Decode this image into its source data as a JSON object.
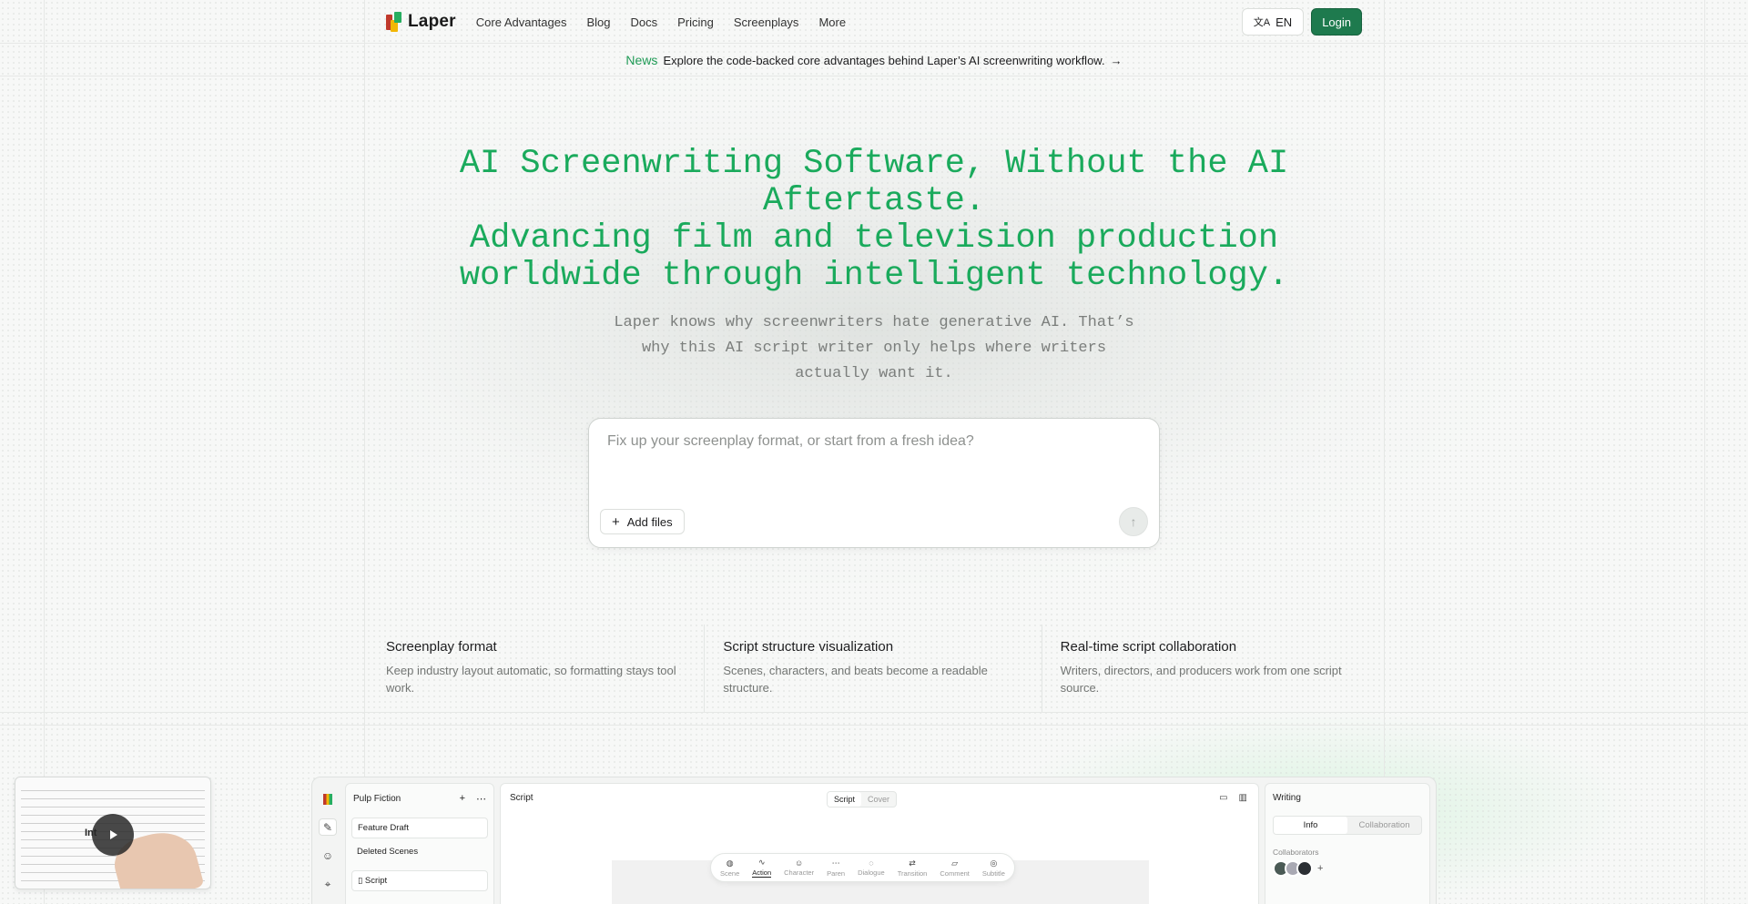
{
  "brand": {
    "name": "Laper"
  },
  "nav": {
    "items": [
      "Core Advantages",
      "Blog",
      "Docs",
      "Pricing",
      "Screenplays",
      "More"
    ]
  },
  "header": {
    "lang_label": "EN",
    "login_label": "Login"
  },
  "news": {
    "tag": "News",
    "text": "Explore the code-backed core advantages behind Laper’s AI screenwriting workflow.",
    "arrow": "→"
  },
  "hero": {
    "title_line1": "AI Screenwriting Software, Without the AI Aftertaste.",
    "title_line2": "Advancing film and television production worldwide through intelligent technology.",
    "subtitle": "Laper knows why screenwriters hate generative AI. That’s why this AI script writer only helps where writers actually want it."
  },
  "prompt": {
    "placeholder": "Fix up your screenplay format, or start from a fresh idea?",
    "value": "",
    "add_files_label": "Add files"
  },
  "features": [
    {
      "title": "Screenplay format",
      "desc": "Keep industry layout automatic, so formatting stays tool work."
    },
    {
      "title": "Script structure visualization",
      "desc": "Scenes, characters, and beats become a readable structure."
    },
    {
      "title": "Real-time script collaboration",
      "desc": "Writers, directors, and producers work from one script source."
    }
  ],
  "video": {
    "label": "Int"
  },
  "app_preview": {
    "project_title": "Pulp Fiction",
    "left_items": [
      "Feature Draft",
      "Deleted Scenes",
      "Script"
    ],
    "main_title": "Script",
    "main_tabs": [
      "Script",
      "Cover"
    ],
    "toolbar": [
      "Scene",
      "Action",
      "Character",
      "Paren",
      "Dialogue",
      "Transition",
      "Comment",
      "Subtitle"
    ],
    "right_title": "Writing",
    "right_tabs": [
      "Info",
      "Collaboration"
    ],
    "collaborators_label": "Collaborators"
  },
  "colors": {
    "accent_green": "#1aaa5c",
    "login_bg": "#1e7a4e"
  }
}
